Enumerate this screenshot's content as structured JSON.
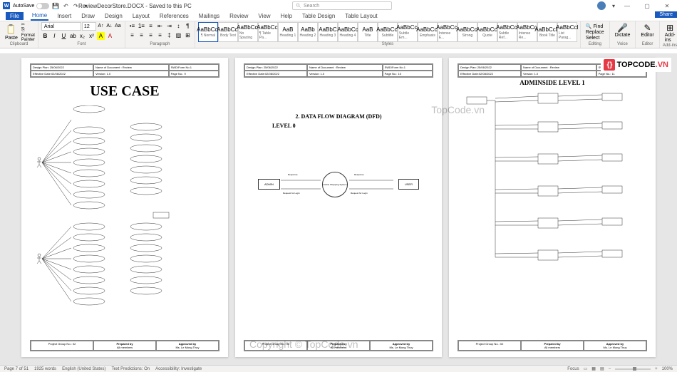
{
  "titlebar": {
    "autosave": "AutoSave",
    "doc_title": "ReviewDecorStore.DOCX - Saved to this PC",
    "search_placeholder": "Search"
  },
  "tabs": {
    "file": "File",
    "home": "Home",
    "insert": "Insert",
    "draw": "Draw",
    "design": "Design",
    "layout": "Layout",
    "references": "References",
    "mailings": "Mailings",
    "review": "Review",
    "view": "View",
    "help": "Help",
    "table_design": "Table Design",
    "table_layout": "Table Layout",
    "share": "Share"
  },
  "ribbon": {
    "paste": "Paste",
    "format_painter": "Format Painter",
    "clipboard": "Clipboard",
    "font_name": "Arial",
    "font_size": "12",
    "font_group": "Font",
    "paragraph": "Paragraph",
    "styles_group": "Styles",
    "styles": [
      {
        "preview": "AaBbCcI",
        "label": "¶ Normal"
      },
      {
        "preview": "AaBbCcI",
        "label": "Body Text"
      },
      {
        "preview": "AaBbCcI",
        "label": "No Spacing"
      },
      {
        "preview": "AaBbCcI",
        "label": "¶ Table Pa..."
      },
      {
        "preview": "AaB",
        "label": "Heading 1"
      },
      {
        "preview": "AaBb",
        "label": "Heading 2"
      },
      {
        "preview": "AaBbC",
        "label": "Heading 3"
      },
      {
        "preview": "AaBbCc",
        "label": "Heading 4"
      },
      {
        "preview": "AaB",
        "label": "Title"
      },
      {
        "preview": "AaBbCcI",
        "label": "Subtitle"
      },
      {
        "preview": "AaBbCcI",
        "label": "Subtle Em..."
      },
      {
        "preview": "AaBbCcI",
        "label": "Emphasis"
      },
      {
        "preview": "AaBbCcI",
        "label": "Intense E..."
      },
      {
        "preview": "AaBbCcI",
        "label": "Strong"
      },
      {
        "preview": "AaBbCcI",
        "label": "Quote"
      },
      {
        "preview": "AaBbCcI",
        "label": "Subtle Ref..."
      },
      {
        "preview": "AaBbCcI",
        "label": "Intense Re..."
      },
      {
        "preview": "AaBbCcD",
        "label": "Book Title"
      },
      {
        "preview": "AaBbCcI",
        "label": "List Parag..."
      }
    ],
    "find": "Find",
    "replace": "Replace",
    "select": "Select",
    "editing": "Editing",
    "dictate": "Dictate",
    "voice": "Voice",
    "editor": "Editor",
    "addins": "Add-ins"
  },
  "document": {
    "page1": {
      "header": {
        "design_plan": "Design Plan:",
        "design_plan_val": "25/06/2022",
        "name_doc": "Name of Document : Review",
        "swd": "SWD/Form No.1",
        "eff_date": "Effective Date:",
        "eff_date_val": "02/08/2022",
        "version": "Version:",
        "version_val": "1.0",
        "page_no": "Page No.:",
        "page_no_val": "9"
      },
      "title": "USE CASE",
      "footer": {
        "project": "Project Group No.:",
        "project_val": "02",
        "prepared": "Prepared by",
        "prepared_val": "All members",
        "approved": "Approved by",
        "approved_val": "Ms. Le Mong Thuy"
      }
    },
    "page2": {
      "header": {
        "design_plan": "Design Plan:",
        "design_plan_val": "25/06/2022",
        "name_doc": "Name of Document : Review",
        "swd": "SWD/Form No.1",
        "eff_date": "Effective Date:",
        "eff_date_val": "02/08/2022",
        "version": "Version:",
        "version_val": "1.0",
        "page_no": "Page No.:",
        "page_no_val": "10"
      },
      "title": "2. DATA FLOW DIAGRAM (DFD)",
      "level": "LEVEL 0",
      "diagram": {
        "admin": "ADMIN",
        "user": "USER",
        "system": "Online Shopping System",
        "response": "Response",
        "req_login": "Request for Login"
      },
      "footer": {
        "project": "Project Group No.:",
        "project_val": "02",
        "prepared": "Prepared by",
        "prepared_val": "All members",
        "approved": "Approved by",
        "approved_val": "Ms. Le Mong Thuy"
      }
    },
    "page3": {
      "header": {
        "design_plan": "Design Plan:",
        "design_plan_val": "25/06/2022",
        "name_doc": "Name of Document : Review",
        "swd": "SWD/Form No.1",
        "eff_date": "Effective Date:",
        "eff_date_val": "02/08/2022",
        "version": "Version:",
        "version_val": "1.0",
        "page_no": "Page No.:",
        "page_no_val": "11"
      },
      "title": "ADMINSIDE LEVEL 1",
      "footer": {
        "project": "Project Group No.:",
        "project_val": "02",
        "prepared": "Prepared by",
        "prepared_val": "All members",
        "approved": "Approved by",
        "approved_val": "Ms. Le Mong Thuy"
      }
    }
  },
  "watermarks": {
    "topcode1": "TopCode.vn",
    "topcode2": "Copyright © TopCode.vn",
    "logo_text": "TOPCODE",
    "logo_suffix": ".VN"
  },
  "statusbar": {
    "page": "Page 7 of 51",
    "words": "1925 words",
    "language": "English (United States)",
    "predictions": "Text Predictions: On",
    "accessibility": "Accessibility: Investigate",
    "focus": "Focus",
    "zoom": "100%"
  }
}
